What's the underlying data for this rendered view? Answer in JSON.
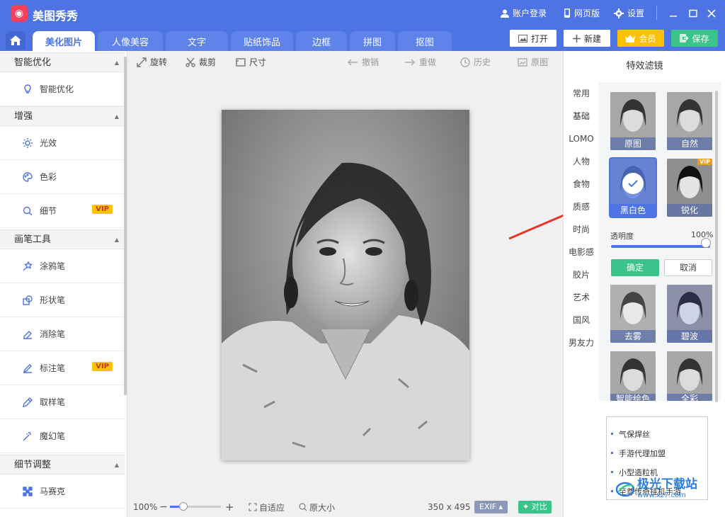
{
  "app": {
    "title": "美图秀秀",
    "logo_glyph": "◉"
  },
  "titlebar": {
    "login": "账户登录",
    "web": "网页版",
    "settings": "设置"
  },
  "tabs": [
    {
      "label": "美化图片",
      "active": true
    },
    {
      "label": "人像美容"
    },
    {
      "label": "文字"
    },
    {
      "label": "贴纸饰品"
    },
    {
      "label": "边框"
    },
    {
      "label": "拼图"
    },
    {
      "label": "抠图"
    }
  ],
  "top_buttons": {
    "open": "打开",
    "new": "新建",
    "vip": "会员",
    "save": "保存"
  },
  "left": {
    "sections": [
      {
        "label": "智能优化",
        "items": [
          {
            "label": "智能优化",
            "icon": "bulb-icon"
          }
        ]
      },
      {
        "label": "增强",
        "items": [
          {
            "label": "光效",
            "icon": "sun-icon"
          },
          {
            "label": "色彩",
            "icon": "palette-icon"
          },
          {
            "label": "细节",
            "icon": "magnify-icon",
            "vip": "VIP"
          }
        ]
      },
      {
        "label": "画笔工具",
        "items": [
          {
            "label": "涂鸦笔",
            "icon": "star-pen-icon"
          },
          {
            "label": "形状笔",
            "icon": "shape-icon"
          },
          {
            "label": "消除笔",
            "icon": "eraser-icon"
          },
          {
            "label": "标注笔",
            "icon": "pen-icon",
            "vip": "VIP"
          },
          {
            "label": "取样笔",
            "icon": "dropper-icon"
          },
          {
            "label": "魔幻笔",
            "icon": "magic-icon"
          }
        ]
      },
      {
        "label": "细节调整",
        "items": [
          {
            "label": "马赛克",
            "icon": "mosaic-icon"
          }
        ]
      }
    ]
  },
  "toolbar": {
    "rotate": "旋转",
    "crop": "裁剪",
    "size": "尺寸",
    "undo": "撤销",
    "redo": "重做",
    "history": "历史",
    "original": "原图"
  },
  "bottom": {
    "zoom": "100%",
    "fit": "自适应",
    "actual": "原大小",
    "dims": "350 x 495",
    "exif": "EXIF",
    "compare": "对比"
  },
  "right": {
    "title": "特效滤镜",
    "categories": [
      "常用",
      "基础",
      "LOMO",
      "人物",
      "食物",
      "质感",
      "时尚",
      "电影感",
      "胶片",
      "艺术",
      "国风",
      "男友力"
    ],
    "active_category": "基础",
    "filters": [
      {
        "label": "原图"
      },
      {
        "label": "自然"
      },
      {
        "label": "黑白色",
        "selected": true
      },
      {
        "label": "锐化",
        "vip": "VIP"
      },
      {
        "label": "去雾"
      },
      {
        "label": "碧波"
      },
      {
        "label": "智能绘色"
      },
      {
        "label": "全彩"
      }
    ],
    "opacity_label": "透明度",
    "opacity_value": "100%",
    "opacity_fraction": 1.0,
    "confirm": "确定",
    "cancel": "取消",
    "ads": [
      "气保焊丝",
      "手游代理加盟",
      "小型造粒机",
      "至尊传奇挂机手游"
    ]
  },
  "watermark": {
    "text1": "极光下载站",
    "text2": "www.xz7.com"
  },
  "colors": {
    "brand": "#4d74e2",
    "confirm": "#3bc48a",
    "vip": "#ffc107",
    "arrow": "#e8352a"
  }
}
